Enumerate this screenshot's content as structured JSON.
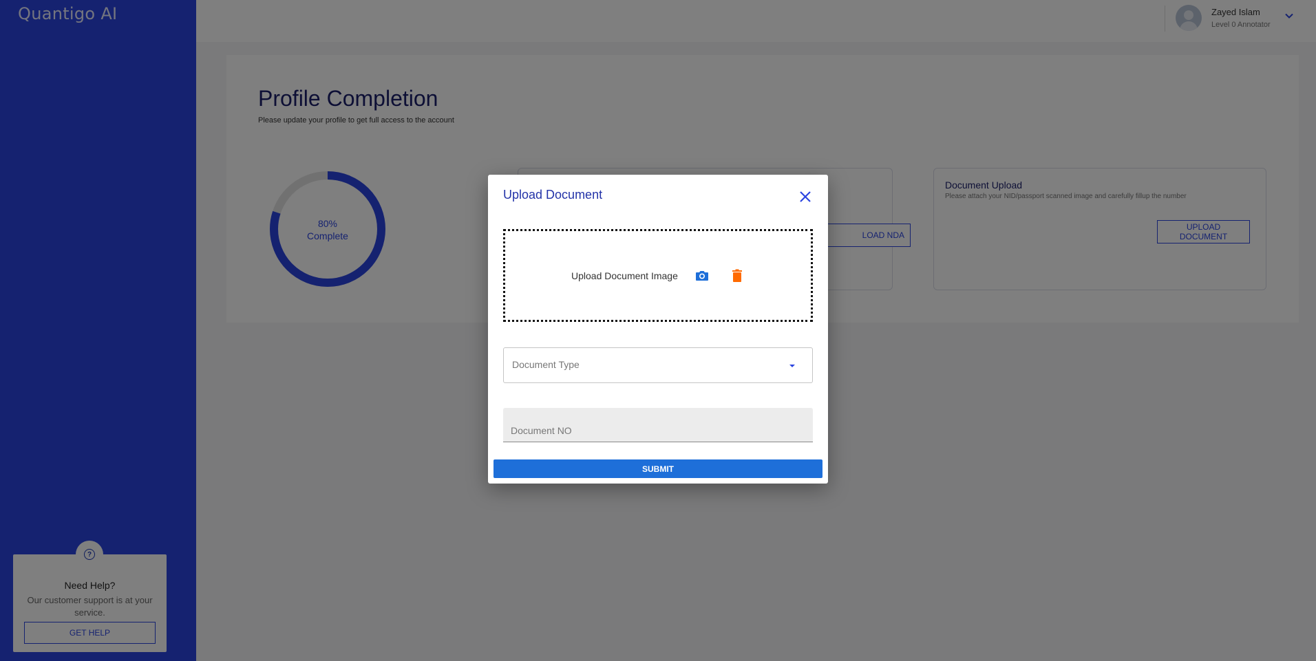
{
  "app": {
    "brand": "Quantigo AI"
  },
  "user": {
    "name": "Zayed Islam",
    "role": "Level 0 Annotator"
  },
  "sidebar": {
    "help": {
      "icon": "question-circle-icon",
      "title": "Need Help?",
      "text": "Our customer support is at your service.",
      "button": "GET HELP"
    }
  },
  "page": {
    "title": "Profile Completion",
    "subtitle": "Please update your profile to get full access to the account",
    "progress": {
      "percent": 80,
      "percent_label": "80%",
      "label": "Complete"
    },
    "tiles": {
      "nda": {
        "button": "LOAD NDA"
      },
      "document": {
        "title": "Document Upload",
        "description": "Please attach your NID/passport scanned image and carefully fillup the number",
        "button": "UPLOAD DOCUMENT"
      }
    }
  },
  "modal": {
    "title": "Upload Document",
    "upload_label": "Upload Document Image",
    "document_type_placeholder": "Document Type",
    "document_no_placeholder": "Document NO",
    "submit": "SUBMIT"
  },
  "colors": {
    "sidebar": "#2b44e0",
    "accent": "#2b44e0",
    "submit": "#1e6fd9",
    "delete": "#ff6a00",
    "camera": "#1e6fd9"
  }
}
